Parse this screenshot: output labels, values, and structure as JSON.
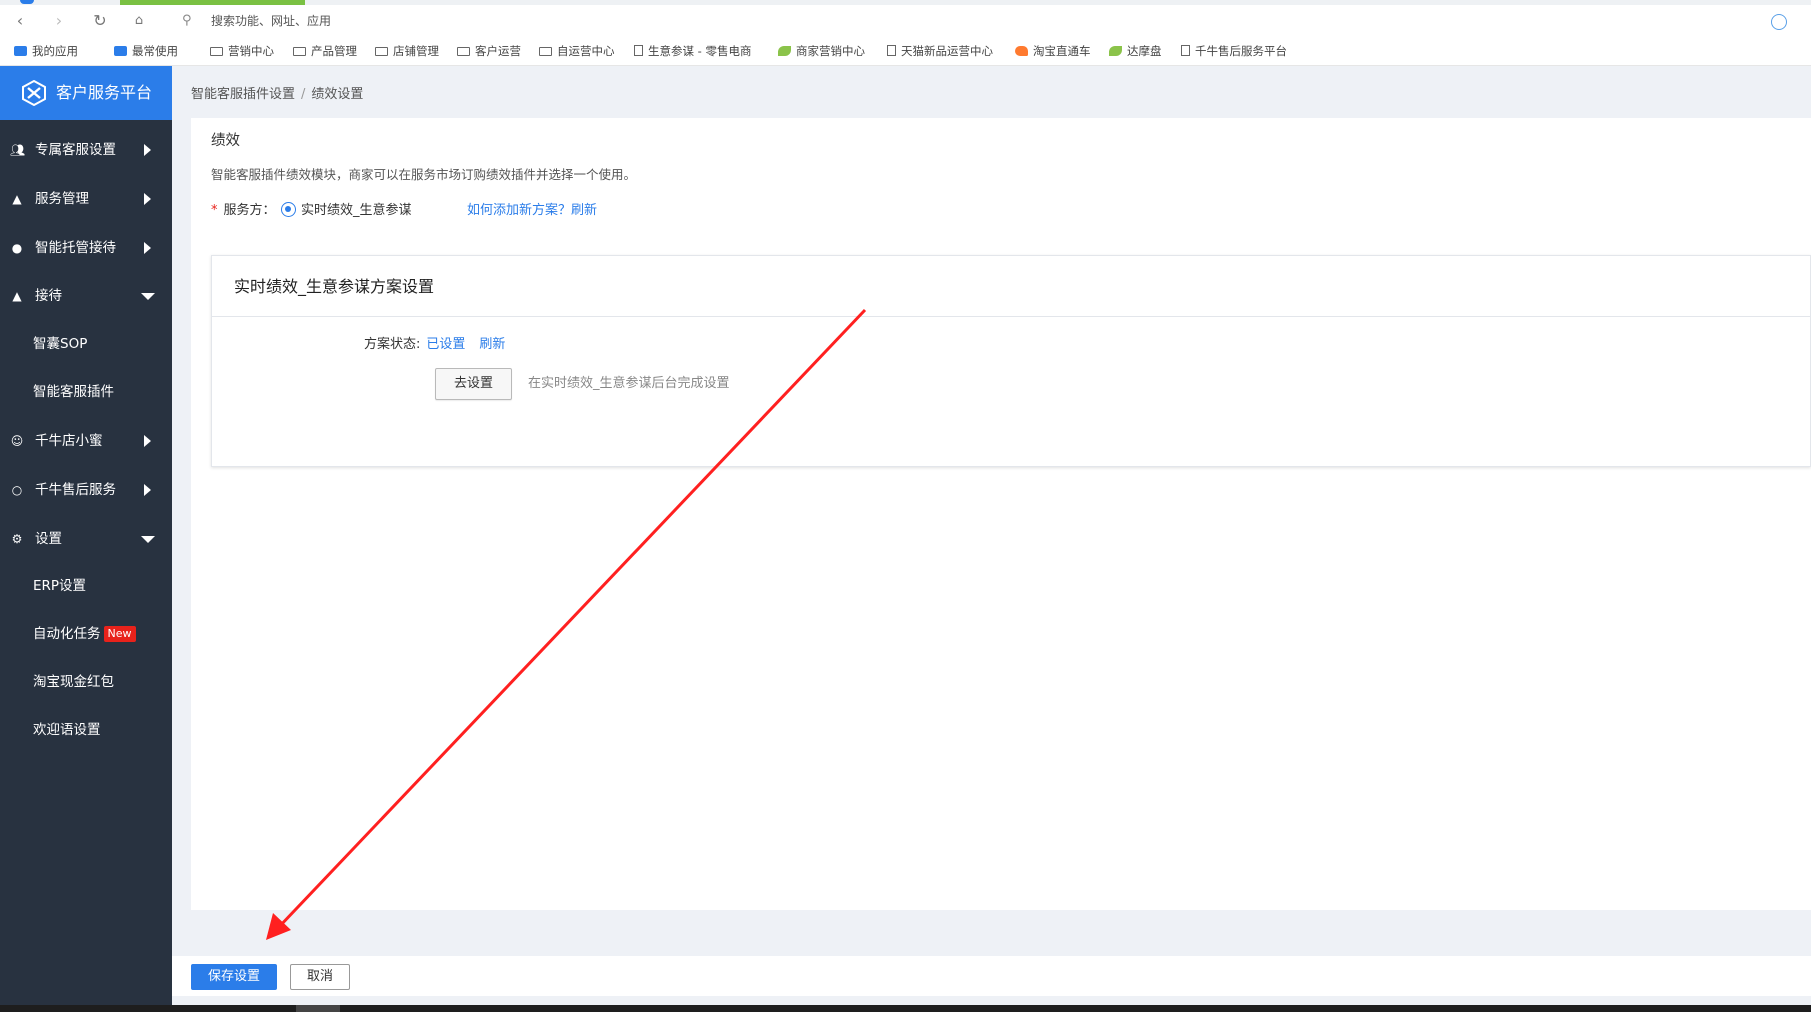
{
  "browser": {
    "address_placeholder": "搜索功能、网址、应用",
    "bookmarks": [
      {
        "label": "我的应用",
        "icon": "app-box-icon"
      },
      {
        "label": "最常使用",
        "icon": "app-box-icon"
      },
      {
        "label": "营销中心",
        "icon": "folder-icon"
      },
      {
        "label": "产品管理",
        "icon": "folder-icon"
      },
      {
        "label": "店铺管理",
        "icon": "folder-icon"
      },
      {
        "label": "客户运营",
        "icon": "folder-icon"
      },
      {
        "label": "自运营中心",
        "icon": "folder-icon"
      },
      {
        "label": "生意参谋 - 零售电商",
        "icon": "page-icon"
      },
      {
        "label": "商家营销中心",
        "icon": "leaf-icon"
      },
      {
        "label": "天猫新品运营中心",
        "icon": "page-icon"
      },
      {
        "label": "淘宝直通车",
        "icon": "flame-icon"
      },
      {
        "label": "达摩盘",
        "icon": "leaf-icon"
      },
      {
        "label": "千牛售后服务平台",
        "icon": "page-icon"
      }
    ]
  },
  "sidebar": {
    "brand_title": "客户服务平台",
    "items": [
      {
        "label": "专属客服设置",
        "icon": "people-icon",
        "arrow": "right"
      },
      {
        "label": "服务管理",
        "icon": "bell-icon",
        "arrow": "right"
      },
      {
        "label": "智能托管接待",
        "icon": "headset-icon",
        "arrow": "right"
      },
      {
        "label": "接待",
        "icon": "people-icon",
        "arrow": "down"
      },
      {
        "label": "千牛店小蜜",
        "icon": "robot-icon",
        "arrow": "right"
      },
      {
        "label": "千牛售后服务",
        "icon": "shield-icon",
        "arrow": "right"
      },
      {
        "label": "设置",
        "icon": "gear-icon",
        "arrow": "down"
      }
    ],
    "sub_items": {
      "reception": [
        "智囊SOP",
        "智能客服插件"
      ],
      "settings": [
        "ERP设置",
        "自动化任务",
        "淘宝现金红包",
        "欢迎语设置"
      ]
    },
    "new_badge": "New"
  },
  "breadcrumb": {
    "parent": "智能客服插件设置",
    "separator": "/",
    "current": "绩效设置"
  },
  "performance": {
    "title": "绩效",
    "description": "智能客服插件绩效模块，商家可以在服务市场订购绩效插件并选择一个使用。",
    "required_mark": "*",
    "provider_label": "服务方：",
    "provider_option": "实时绩效_生意参谋",
    "help_link": "如何添加新方案？",
    "refresh_link": "刷新"
  },
  "plan": {
    "title": "实时绩效_生意参谋方案设置",
    "status_label": "方案状态:",
    "status_value": "已设置",
    "refresh_link": "刷新",
    "goto_button": "去设置",
    "goto_hint": "在实时绩效_生意参谋后台完成设置"
  },
  "footer": {
    "save_button": "保存设置",
    "cancel_button": "取消"
  },
  "colors": {
    "brand_blue": "#2b7de9",
    "sidebar_bg": "#283240",
    "annotation_red": "#ff2020"
  }
}
